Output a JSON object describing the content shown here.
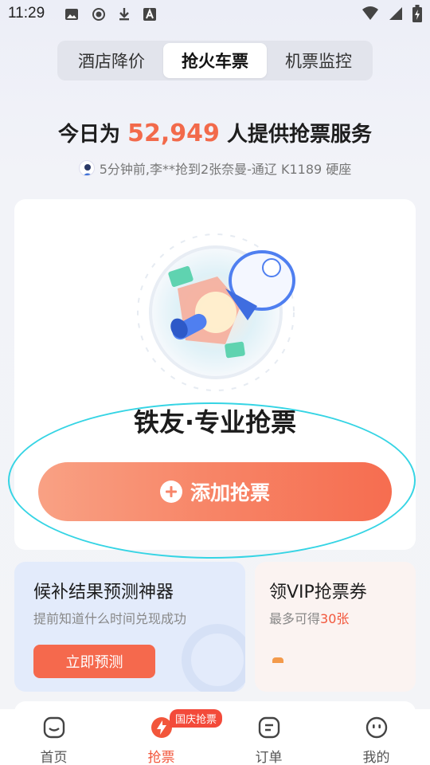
{
  "status_bar": {
    "time": "11:29",
    "left_icons": [
      "image-icon",
      "record-icon",
      "download-icon",
      "a-icon"
    ],
    "right_icons": [
      "wifi-icon",
      "signal-icon",
      "battery-charging-icon"
    ]
  },
  "tabs": [
    {
      "label": "酒店降价",
      "active": false
    },
    {
      "label": "抢火车票",
      "active": true
    },
    {
      "label": "机票监控",
      "active": false
    }
  ],
  "headline": {
    "prefix": "今日为",
    "count": "52,949",
    "suffix": "人提供抢票服务"
  },
  "ticker": {
    "text": "5分钟前,李**抢到2张奈曼-通辽 K1189 硬座"
  },
  "main_card": {
    "title": "铁友·专业抢票",
    "button_label": "添加抢票"
  },
  "promo_left": {
    "title": "候补结果预测神器",
    "subtitle": "提前知道什么时间兑现成功",
    "button_label": "立即预测"
  },
  "promo_right": {
    "title": "领VIP抢票券",
    "subtitle_prefix": "最多可得",
    "subtitle_highlight": "30张"
  },
  "bottom_nav": {
    "items": [
      {
        "label": "首页",
        "icon": "home-icon",
        "active": false
      },
      {
        "label": "抢票",
        "icon": "bolt-icon",
        "active": true,
        "badge": "国庆抢票"
      },
      {
        "label": "订单",
        "icon": "order-icon",
        "active": false
      },
      {
        "label": "我的",
        "icon": "profile-icon",
        "active": false
      }
    ]
  },
  "colors": {
    "accent": "#f2563b",
    "button_gradient_start": "#f9a184",
    "button_gradient_end": "#f66d50",
    "highlight_ring": "#35d4e4"
  }
}
